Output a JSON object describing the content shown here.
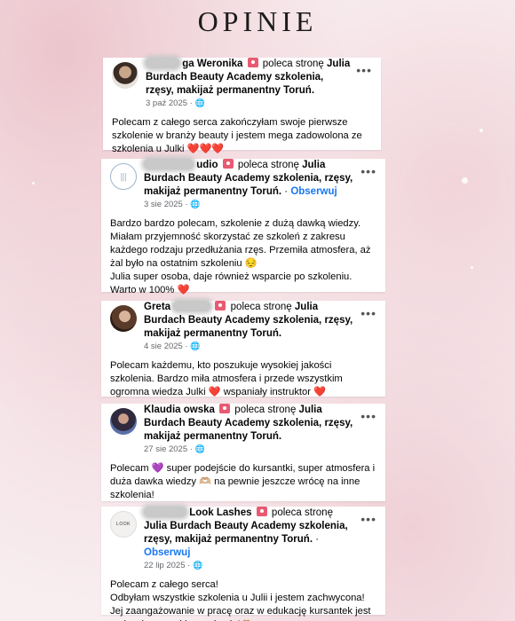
{
  "page": {
    "title": "OPINIE"
  },
  "reviews": [
    {
      "name_visible": "ga Weronika",
      "action": "poleca stronę",
      "page_name": "Julia Burdach Beauty Academy szkolenia, rzęsy, makijaż permanentny Toruń.",
      "follow": "",
      "date": "3 paź 2025",
      "privacy_icon": "globe",
      "text": "Polecam z całego serca zakończyłam swoje pierwsze szkolenie w branży beauty i jestem mega zadowolona ze szkolenia u Julki ❤️❤️❤️"
    },
    {
      "name_visible": "udio",
      "action": "poleca stronę",
      "page_name": "Julia Burdach Beauty Academy szkolenia, rzęsy, makijaż permanentny Toruń.",
      "follow": "Obserwuj",
      "date": "3 sie 2025",
      "privacy_icon": "globe",
      "text": "Bardzo bardzo polecam, szkolenie z dużą dawką wiedzy.\nMiałam przyjemność skorzystać ze szkoleń z zakresu każdego rodzaju przedłużania rzęs. Przemiła atmosfera, aż żal było na ostatnim szkoleniu 😔\nJulia super osoba, daje również wsparcie po szkoleniu. Warto w 100% ❤️"
    },
    {
      "name_visible": "Greta",
      "action": "poleca stronę",
      "page_name": "Julia Burdach Beauty Academy szkolenia, rzęsy, makijaż permanentny Toruń.",
      "follow": "",
      "date": "4 sie 2025",
      "privacy_icon": "globe",
      "text": "Polecam każdemu, kto poszukuje wysokiej jakości szkolenia. Bardzo miła atmosfera i przede wszystkim ogromna wiedza Julki ❤️ wspaniały instruktor ❤️"
    },
    {
      "name_visible": "Klaudia owska",
      "action": "poleca stronę",
      "page_name": "Julia Burdach Beauty Academy szkolenia, rzęsy, makijaż permanentny Toruń.",
      "follow": "",
      "date": "27 sie 2025",
      "privacy_icon": "globe",
      "text": "Polecam 💜 super podejście do kursantki, super atmosfera i duża dawka wiedzy 🫶🏼 na pewnie jeszcze wrócę na inne szkolenia!"
    },
    {
      "name_visible": "Look Lashes",
      "action": "poleca stronę",
      "page_name": "Julia Burdach Beauty Academy szkolenia, rzęsy, makijaż permanentny Toruń.",
      "follow": "Obserwuj",
      "date": "22 lip 2025",
      "privacy_icon": "globe",
      "text": "Polecam z całego serca!\nOdbyłam wszystkie szkolenia u Julii i jestem zachwycona!\nJej zaangażowanie w pracę oraz w edukację kursantek jest na bardzo wysokim poziomie!🫶🏼"
    }
  ]
}
